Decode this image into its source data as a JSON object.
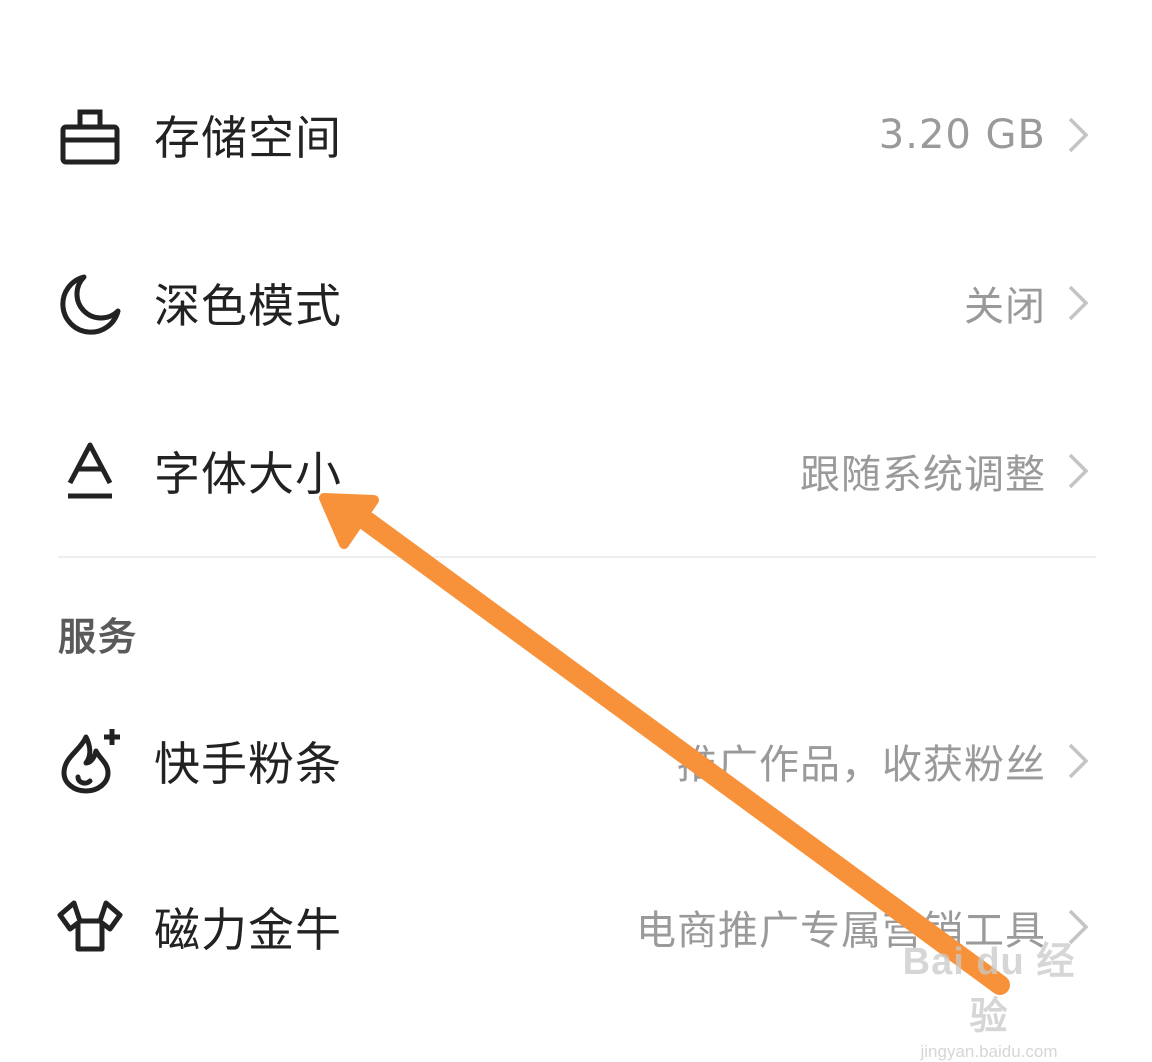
{
  "settings": [
    {
      "id": "storage",
      "icon": "toolbox-icon",
      "label": "存储空间",
      "value": "3.20 GB"
    },
    {
      "id": "dark",
      "icon": "moon-icon",
      "label": "深色模式",
      "value": "关闭"
    },
    {
      "id": "font",
      "icon": "font-size-icon",
      "label": "字体大小",
      "value": "跟随系统调整"
    }
  ],
  "services": {
    "title": "服务",
    "items": [
      {
        "id": "fans",
        "icon": "flame-plus-icon",
        "label": "快手粉条",
        "value": "推广作品，收获粉丝"
      },
      {
        "id": "niu",
        "icon": "bull-icon",
        "label": "磁力金牛",
        "value": "电商推广专属营销工具"
      }
    ]
  },
  "annotation": {
    "arrow_color": "#f7923a"
  },
  "watermark": {
    "main": "Bai du 经验",
    "sub": "jingyan.baidu.com"
  },
  "colors": {
    "label": "#222222",
    "value": "#9a9a9a",
    "section": "#5a5a5a",
    "chevron": "#c4c4c4",
    "divider": "#eeeeee"
  }
}
